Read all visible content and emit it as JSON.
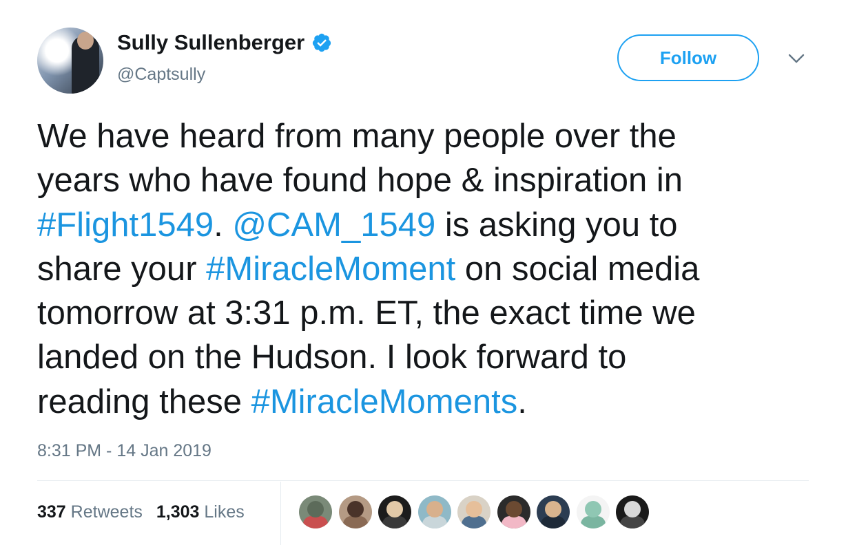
{
  "author": {
    "name": "Sully Sullenberger",
    "handle": "@Captsully",
    "verified": true
  },
  "follow_label": "Follow",
  "tweet": {
    "lines": [
      [
        {
          "t": "We have heard from many people over the",
          "link": false
        }
      ],
      [
        {
          "t": "years who have found hope & inspiration in",
          "link": false
        }
      ],
      [
        {
          "t": "#Flight1549",
          "link": true
        },
        {
          "t": ". ",
          "link": false
        },
        {
          "t": "@CAM_1549",
          "link": true
        },
        {
          "t": " is asking you to",
          "link": false
        }
      ],
      [
        {
          "t": "share your ",
          "link": false
        },
        {
          "t": "#MiracleMoment",
          "link": true
        },
        {
          "t": " on social media",
          "link": false
        }
      ],
      [
        {
          "t": "tomorrow at 3:31 p.m. ET, the exact time we",
          "link": false
        }
      ],
      [
        {
          "t": "landed on the Hudson. I look forward to",
          "link": false
        }
      ],
      [
        {
          "t": "reading these ",
          "link": false
        },
        {
          "t": "#MiracleMoments",
          "link": true
        },
        {
          "t": ".",
          "link": false
        }
      ]
    ]
  },
  "timestamp": "8:31 PM - 14 Jan 2019",
  "stats": {
    "retweets_count": "337",
    "retweets_label": "Retweets",
    "likes_count": "1,303",
    "likes_label": "Likes"
  },
  "likers": [
    {
      "name": "liker-1",
      "bg": "#7a8a78",
      "face": "#5c6b5a",
      "body": "#c94f4f"
    },
    {
      "name": "liker-2",
      "bg": "#b49a84",
      "face": "#4a3329",
      "body": "#8a6a54"
    },
    {
      "name": "liker-3",
      "bg": "#1c1c1c",
      "face": "#e2c9a8",
      "body": "#3a3a3a"
    },
    {
      "name": "liker-4",
      "bg": "#8fb9c7",
      "face": "#d8b08c",
      "body": "#c9d6da"
    },
    {
      "name": "liker-5",
      "bg": "#d9d2c6",
      "face": "#e6bf9a",
      "body": "#4f6f8f"
    },
    {
      "name": "liker-6",
      "bg": "#2b2b2b",
      "face": "#6b4a32",
      "body": "#f2b8c6"
    },
    {
      "name": "liker-7",
      "bg": "#2c3d52",
      "face": "#d9b48e",
      "body": "#1e2a38"
    },
    {
      "name": "liker-8",
      "bg": "#f4f4f4",
      "face": "#8fc7b3",
      "body": "#7ab5a0"
    },
    {
      "name": "liker-9",
      "bg": "#1a1a1a",
      "face": "#d8d8d8",
      "body": "#444444"
    }
  ],
  "colors": {
    "accent": "#1da1f2",
    "link": "#1b95e0",
    "muted": "#657786",
    "text": "#14171a"
  },
  "icons": {
    "verified": "verified-badge-icon",
    "menu": "chevron-down-icon"
  }
}
